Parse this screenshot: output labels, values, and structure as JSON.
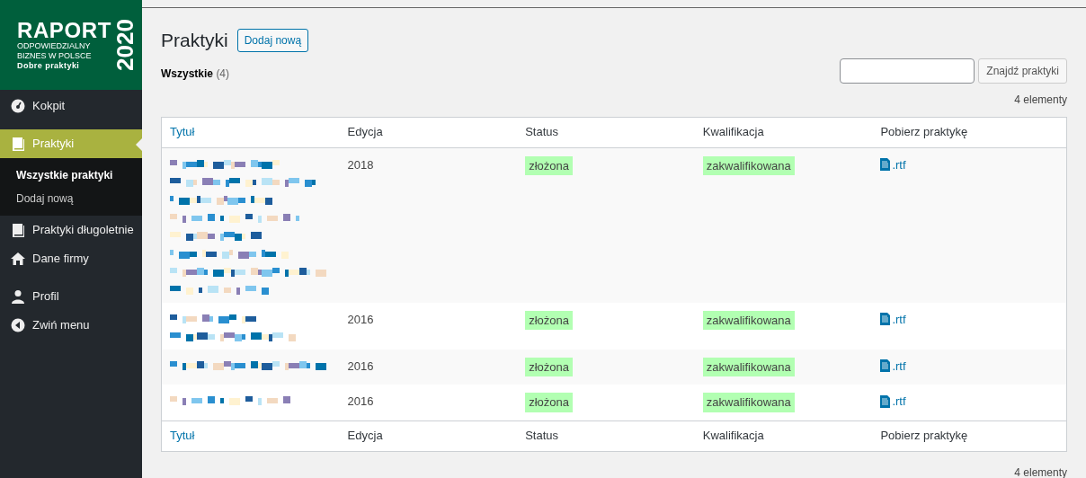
{
  "logo": {
    "title": "RAPORT",
    "lines": [
      "ODPOWIEDZIALNY",
      "BIZNES W POLSCE"
    ],
    "subtitle": "Dobre praktyki",
    "year": "2020"
  },
  "menu": [
    {
      "kind": "gauge",
      "label": "Kokpit",
      "selected": false
    },
    {
      "kind": "book",
      "label": "Praktyki",
      "selected": true,
      "children": [
        {
          "label": "Wszystkie praktyki",
          "selected": true
        },
        {
          "label": "Dodaj nową",
          "selected": false
        }
      ]
    },
    {
      "kind": "book",
      "label": "Praktyki długoletnie",
      "selected": false
    },
    {
      "kind": "home",
      "label": "Dane firmy",
      "selected": false
    },
    {
      "kind": "user",
      "label": "Profil",
      "selected": false
    },
    {
      "kind": "collapse",
      "label": "Zwiń menu",
      "selected": false
    }
  ],
  "page": {
    "title": "Praktyki",
    "add_button": "Dodaj nową"
  },
  "filters": [
    {
      "label": "Wszystkie",
      "count": "(4)",
      "selected": true
    }
  ],
  "search": {
    "button": "Znajdź praktyki"
  },
  "count_top": "4 elementy",
  "table": {
    "columns": [
      "Tytuł",
      "Edycja",
      "Status",
      "Kwalifikacja",
      "Pobierz praktykę"
    ],
    "rows": [
      {
        "title_lines": [
          {
            "kind": "pixelated"
          },
          {
            "kind": "pixelated"
          },
          {
            "kind": "pixelated"
          },
          {
            "kind": "pixelated"
          },
          {
            "kind": "pixelated"
          },
          {
            "kind": "pixelated"
          },
          {
            "kind": "pixelated"
          },
          {
            "kind": "pixelated"
          }
        ],
        "edition": "2018",
        "status": "złożona",
        "qualification": "zakwalifikowana",
        "download": ".rtf"
      },
      {
        "title_lines": [
          {
            "kind": "pixelated"
          },
          {
            "kind": "pixelated"
          }
        ],
        "edition": "2016",
        "status": "złożona",
        "qualification": "zakwalifikowana",
        "download": ".rtf"
      },
      {
        "title_lines": [
          {
            "kind": "pixelated"
          }
        ],
        "edition": "2016",
        "status": "złożona",
        "qualification": "zakwalifikowana",
        "download": ".rtf"
      },
      {
        "title_lines": [
          {
            "kind": "pixelated"
          }
        ],
        "edition": "2016",
        "status": "złożona",
        "qualification": "zakwalifikowana",
        "download": ".rtf"
      }
    ],
    "footer_columns": [
      "Tytuł",
      "Edycja",
      "Status",
      "Kwalifikacja",
      "Pobierz praktykę"
    ]
  },
  "count_bottom": "4 elementy"
}
